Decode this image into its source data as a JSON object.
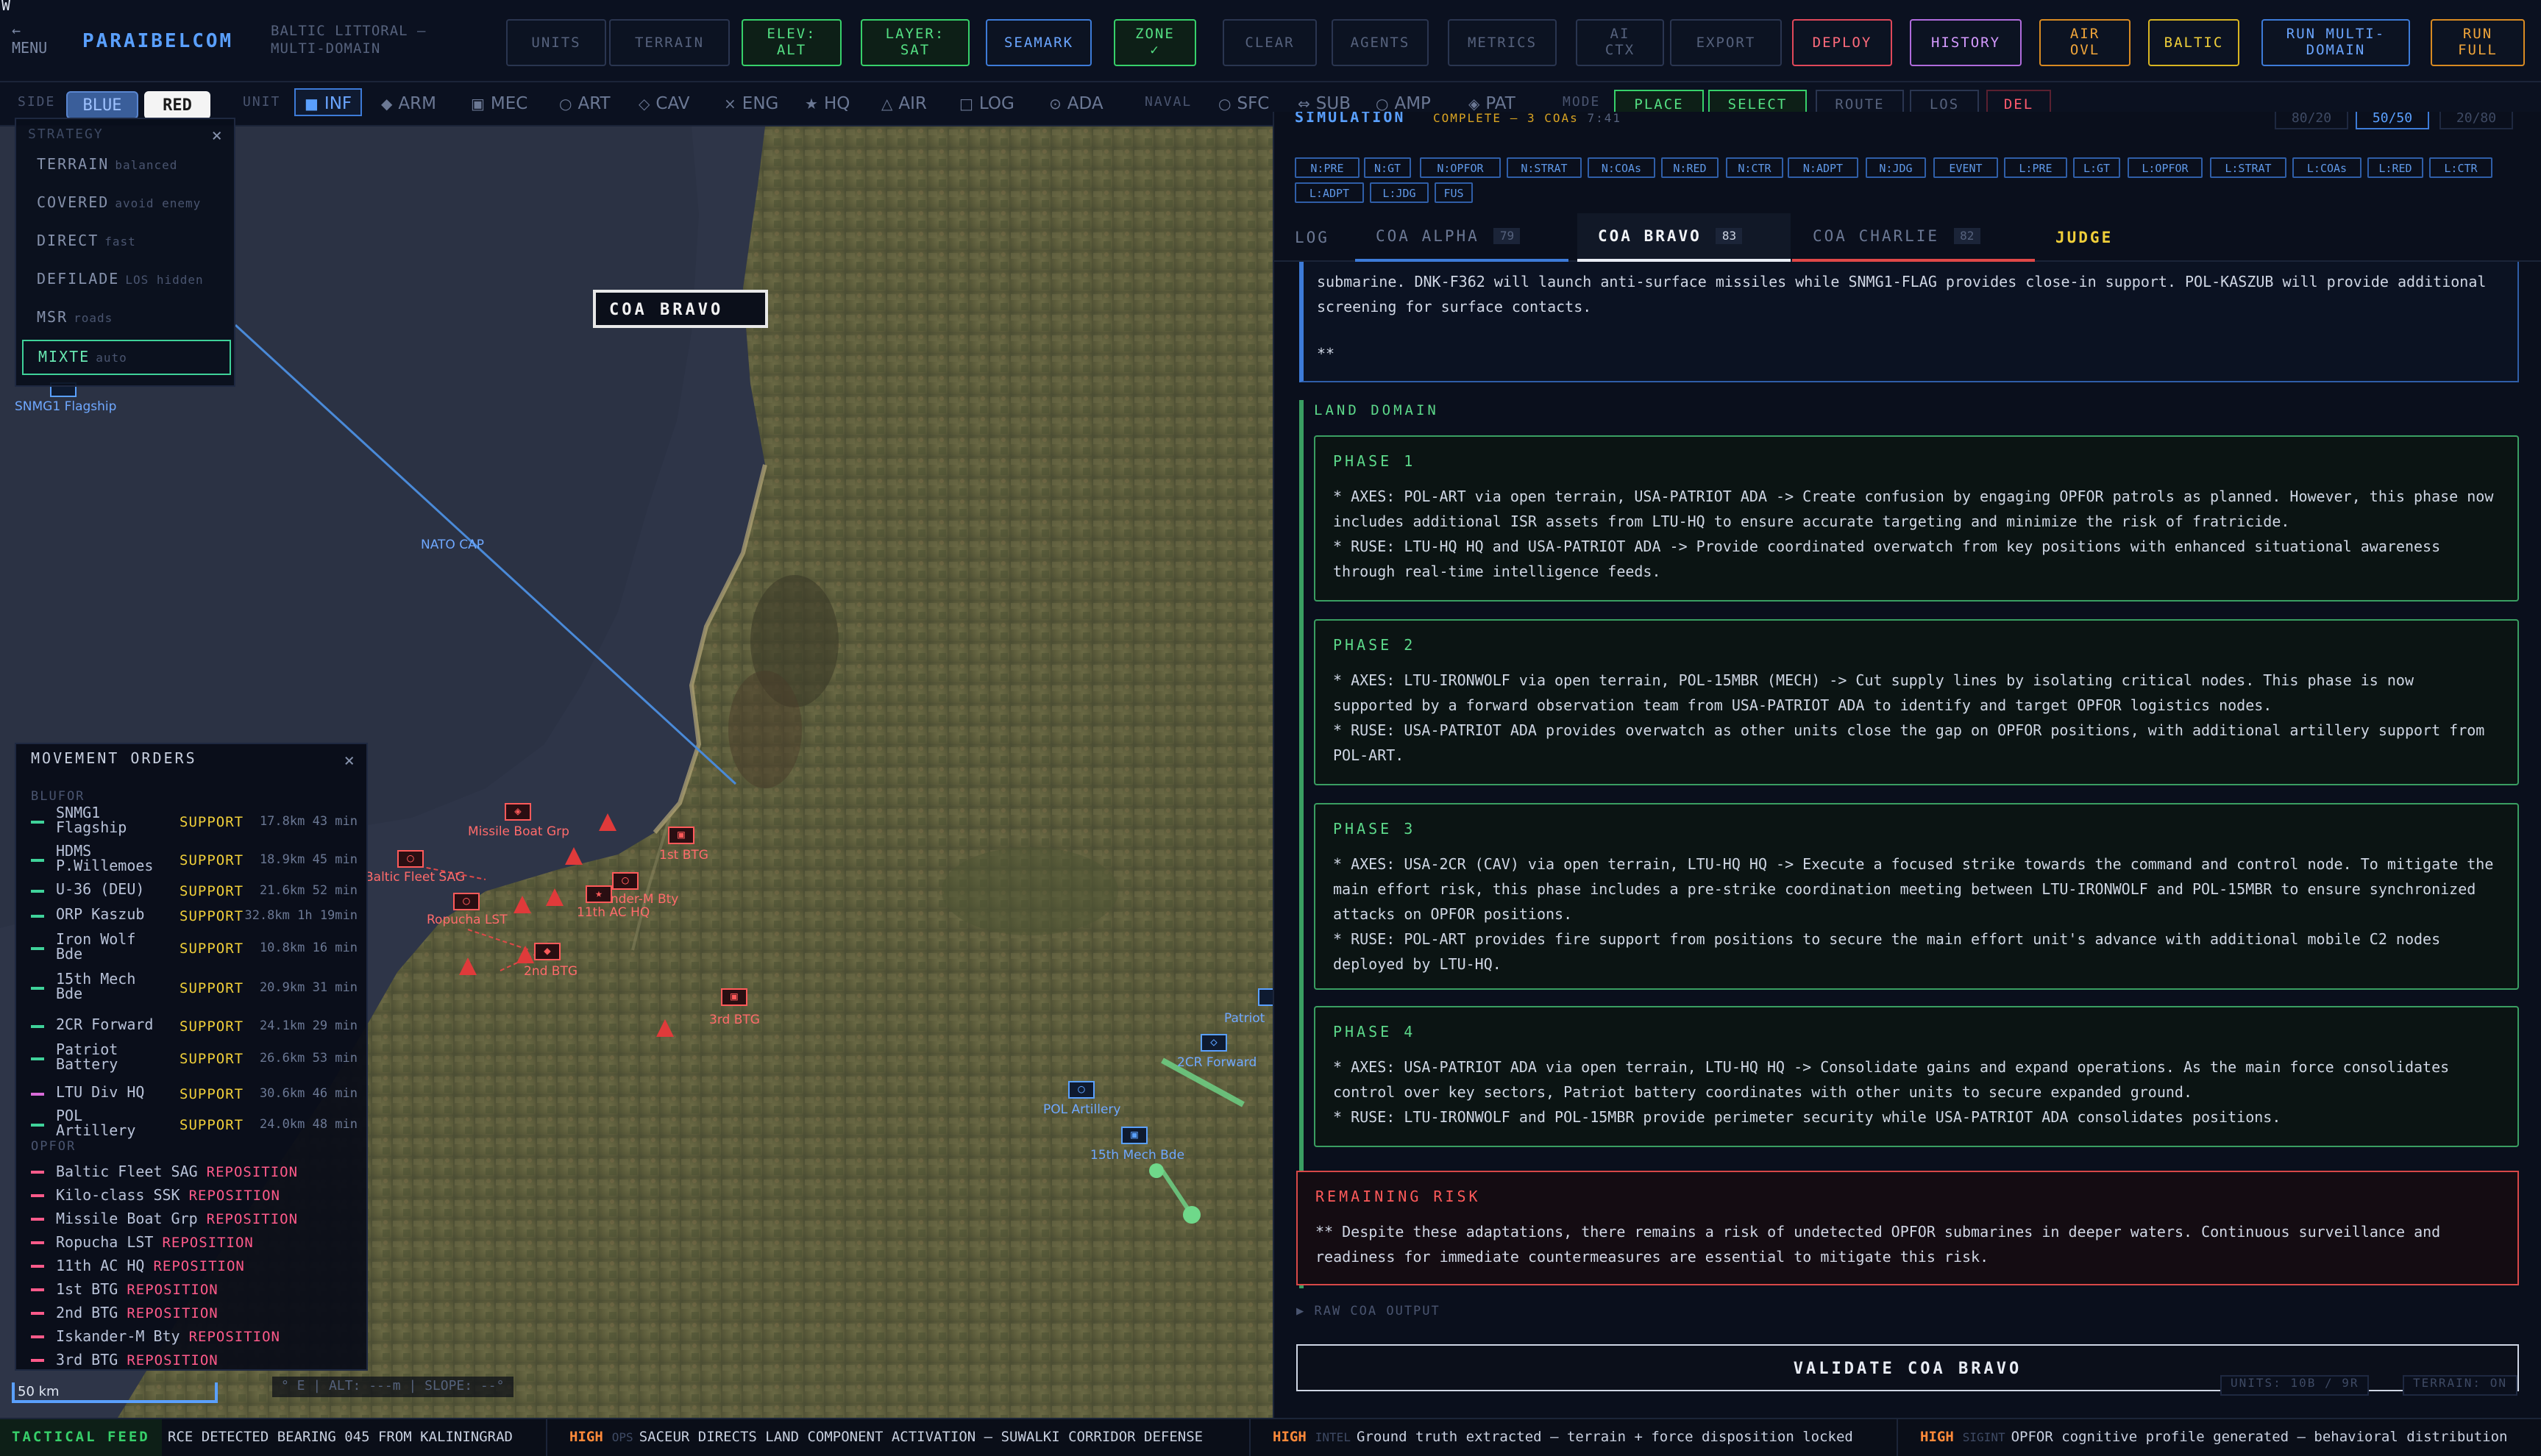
{
  "topbar": {
    "menu_label": "←\nMENU",
    "brand": "PARAIBELCOM",
    "scenario": "BALTIC LITTORAL —\nMULTI-DOMAIN",
    "buttons": [
      {
        "label": "UNITS",
        "style": "dim"
      },
      {
        "label": "TERRAIN",
        "style": "dim"
      },
      {
        "label": "ELEV:\nALT",
        "style": "green"
      },
      {
        "label": "LAYER:\nSAT",
        "style": "green"
      },
      {
        "label": "SEAMARK",
        "style": "blue"
      },
      {
        "label": "ZONE\n✓",
        "style": "green"
      },
      {
        "label": "CLEAR",
        "style": "dim"
      },
      {
        "label": "AGENTS",
        "style": "dim"
      },
      {
        "label": "METRICS",
        "style": "dim"
      },
      {
        "label": "AI\nCTX",
        "style": "dim"
      },
      {
        "label": "EXPORT",
        "style": "dim"
      },
      {
        "label": "DEPLOY",
        "style": "red"
      },
      {
        "label": "HISTORY",
        "style": "purple"
      },
      {
        "label": "AIR\nOVL",
        "style": "orange"
      },
      {
        "label": "BALTIC",
        "style": "yellow"
      },
      {
        "label": "RUN MULTI-\nDOMAIN",
        "style": "blue"
      },
      {
        "label": "RUN\nFULL",
        "style": "orange"
      }
    ]
  },
  "toolbar2": {
    "side_label": "SIDE",
    "blue_label": "BLUE",
    "red_label": "RED",
    "unit_label": "UNIT",
    "units": [
      "INF",
      "ARM",
      "MEC",
      "ART",
      "CAV",
      "ENG",
      "HQ",
      "AIR",
      "LOG",
      "ADA"
    ],
    "unit_icons": [
      "■",
      "◆",
      "▣",
      "○",
      "◇",
      "×",
      "★",
      "△",
      "□",
      "⊙"
    ],
    "naval_label": "NAVAL",
    "naval_units": [
      "SFC",
      "SUB",
      "AMP",
      "PAT"
    ],
    "naval_icons": [
      "○",
      "⇔",
      "○",
      "◈"
    ],
    "mode_label": "MODE",
    "modes": [
      {
        "label": "PLACE",
        "style": "green"
      },
      {
        "label": "SELECT",
        "style": "green"
      },
      {
        "label": "ROUTE",
        "style": "dim"
      },
      {
        "label": "LOS",
        "style": "dim"
      },
      {
        "label": "DEL",
        "style": "red"
      }
    ]
  },
  "strategy": {
    "header": "STRATEGY",
    "close": "×",
    "items": [
      {
        "label": "TERRAIN",
        "sub": "balanced"
      },
      {
        "label": "COVERED",
        "sub": "avoid enemy"
      },
      {
        "label": "DIRECT",
        "sub": "fast"
      },
      {
        "label": "DEFILADE",
        "sub": "LOS hidden"
      },
      {
        "label": "MSR",
        "sub": "roads"
      },
      {
        "label": "MIXTE",
        "sub": "auto"
      }
    ]
  },
  "map": {
    "coa_label": "COA BRAVO",
    "nato_cap": "NATO CAP",
    "scale": "50 km",
    "cursor_readout": "° E | ALT: ---m | SLOPE: --°",
    "edge_letter": "W",
    "blue_units": [
      "SNMG1 Flagship",
      "POL Artillery",
      "15th Mech Bde",
      "2CR Forward",
      "Patriot"
    ],
    "red_units": [
      "Missile Boat Grp",
      "Baltic Fleet SAG",
      "1st BTG",
      "Ropucha LST",
      "Iskander-M Bty",
      "11th AC HQ",
      "2nd BTG",
      "3rd BTG"
    ]
  },
  "movement_orders": {
    "title": "MOVEMENT ORDERS",
    "close": "×",
    "blufor_label": "BLUFOR",
    "opfor_label": "OPFOR",
    "blufor": [
      {
        "name": "SNMG1\nFlagship",
        "action": "SUPPORT",
        "meta": "17.8km 43 min",
        "color": "#3fd29a"
      },
      {
        "name": "HDMS\nP.Willemoes",
        "action": "SUPPORT",
        "meta": "18.9km 45 min",
        "color": "#3fd29a"
      },
      {
        "name": "U-36 (DEU)",
        "action": "SUPPORT",
        "meta": "21.6km 52 min",
        "color": "#3fd29a"
      },
      {
        "name": "ORP Kaszub",
        "action": "SUPPORT",
        "meta": "32.8km 1h 19min",
        "color": "#3fd29a"
      },
      {
        "name": "Iron Wolf\nBde",
        "action": "SUPPORT",
        "meta": "10.8km 16 min",
        "color": "#3fd29a"
      },
      {
        "name": "15th Mech\nBde",
        "action": "SUPPORT",
        "meta": "20.9km 31 min",
        "color": "#3fd29a"
      },
      {
        "name": "2CR Forward",
        "action": "SUPPORT",
        "meta": "24.1km 29 min",
        "color": "#3fd29a"
      },
      {
        "name": "Patriot\nBattery",
        "action": "SUPPORT",
        "meta": "26.6km 53 min",
        "color": "#3fd29a"
      },
      {
        "name": "LTU Div HQ",
        "action": "SUPPORT",
        "meta": "30.6km 46 min",
        "color": "#d86bd8"
      },
      {
        "name": "POL\nArtillery",
        "action": "SUPPORT",
        "meta": "24.0km 48 min",
        "color": "#3fd29a"
      }
    ],
    "opfor": [
      {
        "name": "Baltic Fleet SAG",
        "action": "REPOSITION",
        "color": "#ff5a8a"
      },
      {
        "name": "Kilo-class SSK",
        "action": "REPOSITION",
        "color": "#ff5a8a"
      },
      {
        "name": "Missile Boat Grp",
        "action": "REPOSITION",
        "color": "#ff5a8a"
      },
      {
        "name": "Ropucha LST",
        "action": "REPOSITION",
        "color": "#ff5a8a"
      },
      {
        "name": "11th AC HQ",
        "action": "REPOSITION",
        "color": "#ff5a8a"
      },
      {
        "name": "1st BTG",
        "action": "REPOSITION",
        "color": "#ff5a8a"
      },
      {
        "name": "2nd BTG",
        "action": "REPOSITION",
        "color": "#ff5a8a"
      },
      {
        "name": "Iskander-M Bty",
        "action": "REPOSITION",
        "color": "#ff5a8a"
      },
      {
        "name": "3rd BTG",
        "action": "REPOSITION",
        "color": "#ff5a8a"
      }
    ]
  },
  "sim": {
    "title": "SIMULATION",
    "status": "COMPLETE — 3 COAs",
    "time": "7:41",
    "ratios": [
      "80/20",
      "50/50",
      "20/80"
    ],
    "chips": [
      "N:PRE",
      "N:GT",
      "N:OPFOR",
      "N:STRAT",
      "N:COAs",
      "N:RED",
      "N:CTR",
      "N:ADPT",
      "N:JDG",
      "EVENT",
      "L:PRE",
      "L:GT",
      "L:OPFOR",
      "L:STRAT",
      "L:COAs",
      "L:RED",
      "L:CTR",
      "L:ADPT",
      "L:JDG",
      "FUS"
    ],
    "tabs": [
      {
        "label": "LOG",
        "score": ""
      },
      {
        "label": "COA ALPHA",
        "score": "79"
      },
      {
        "label": "COA BRAVO",
        "score": "83"
      },
      {
        "label": "COA CHARLIE",
        "score": "82"
      },
      {
        "label": "JUDGE",
        "score": ""
      }
    ],
    "naval_excerpt": "submarine. DNK-F362 will launch anti-surface missiles while SNMG1-FLAG provides close-in support. POL-KASZUB will provide additional screening for surface contacts.",
    "naval_tail": "**",
    "land_domain": "LAND DOMAIN",
    "phases": [
      {
        "title": "PHASE 1",
        "text": "* AXES: POL-ART via open terrain, USA-PATRIOT ADA -> Create confusion by engaging OPFOR patrols as planned. However, this phase now includes additional ISR assets from LTU-HQ to ensure accurate targeting and minimize the risk of fratricide.\n* RUSE: LTU-HQ HQ and USA-PATRIOT ADA -> Provide coordinated overwatch from key positions with enhanced situational awareness through real-time intelligence feeds."
      },
      {
        "title": "PHASE 2",
        "text": "* AXES: LTU-IRONWOLF via open terrain, POL-15MBR (MECH) -> Cut supply lines by isolating critical nodes. This phase is now supported by a forward observation team from USA-PATRIOT ADA to identify and target OPFOR logistics nodes.\n* RUSE: USA-PATRIOT ADA provides overwatch as other units close the gap on OPFOR positions, with additional artillery support from POL-ART."
      },
      {
        "title": "PHASE 3",
        "text": "* AXES: USA-2CR (CAV) via open terrain, LTU-HQ HQ -> Execute a focused strike towards the command and control node. To mitigate the main effort risk, this phase includes a pre-strike coordination meeting between LTU-IRONWOLF and POL-15MBR to ensure synchronized attacks on OPFOR positions.\n* RUSE: POL-ART provides fire support from positions to secure the main effort unit's advance with additional mobile C2 nodes deployed by LTU-HQ."
      },
      {
        "title": "PHASE 4",
        "text": "* AXES: USA-PATRIOT ADA via open terrain, LTU-HQ HQ -> Consolidate gains and expand operations. As the main force consolidates control over key sectors, Patriot battery coordinates with other units to secure expanded ground.\n* RUSE: LTU-IRONWOLF and POL-15MBR provide perimeter security while USA-PATRIOT ADA consolidates positions."
      }
    ],
    "risk_title": "REMAINING RISK",
    "risk_text": "** Despite these adaptations, there remains a risk of undetected OPFOR submarines in deeper waters. Continuous surveillance and readiness for immediate countermeasures are essential to mitigate this risk.",
    "raw_toggle": "▶ RAW COA OUTPUT",
    "validate": "VALIDATE COA BRAVO",
    "units_count": "UNITS: 10B / 9R",
    "terrain_status": "TERRAIN: ON"
  },
  "feed": {
    "label": "TACTICAL FEED",
    "items": [
      {
        "level": "",
        "tag": "",
        "text": "RCE DETECTED BEARING 045 FROM KALININGRAD"
      },
      {
        "level": "HIGH",
        "tag": "OPS",
        "text": "SACEUR DIRECTS LAND COMPONENT ACTIVATION — SUWALKI CORRIDOR DEFENSE"
      },
      {
        "level": "HIGH",
        "tag": "INTEL",
        "text": "Ground truth extracted — terrain + force disposition locked"
      },
      {
        "level": "HIGH",
        "tag": "SIGINT",
        "text": "OPFOR cognitive profile generated — behavioral distribution"
      }
    ]
  },
  "colors": {
    "accent": "#5aa0ff",
    "green": "#37d06a",
    "red": "#ff5a6e",
    "bg": "#0a0f1c"
  }
}
